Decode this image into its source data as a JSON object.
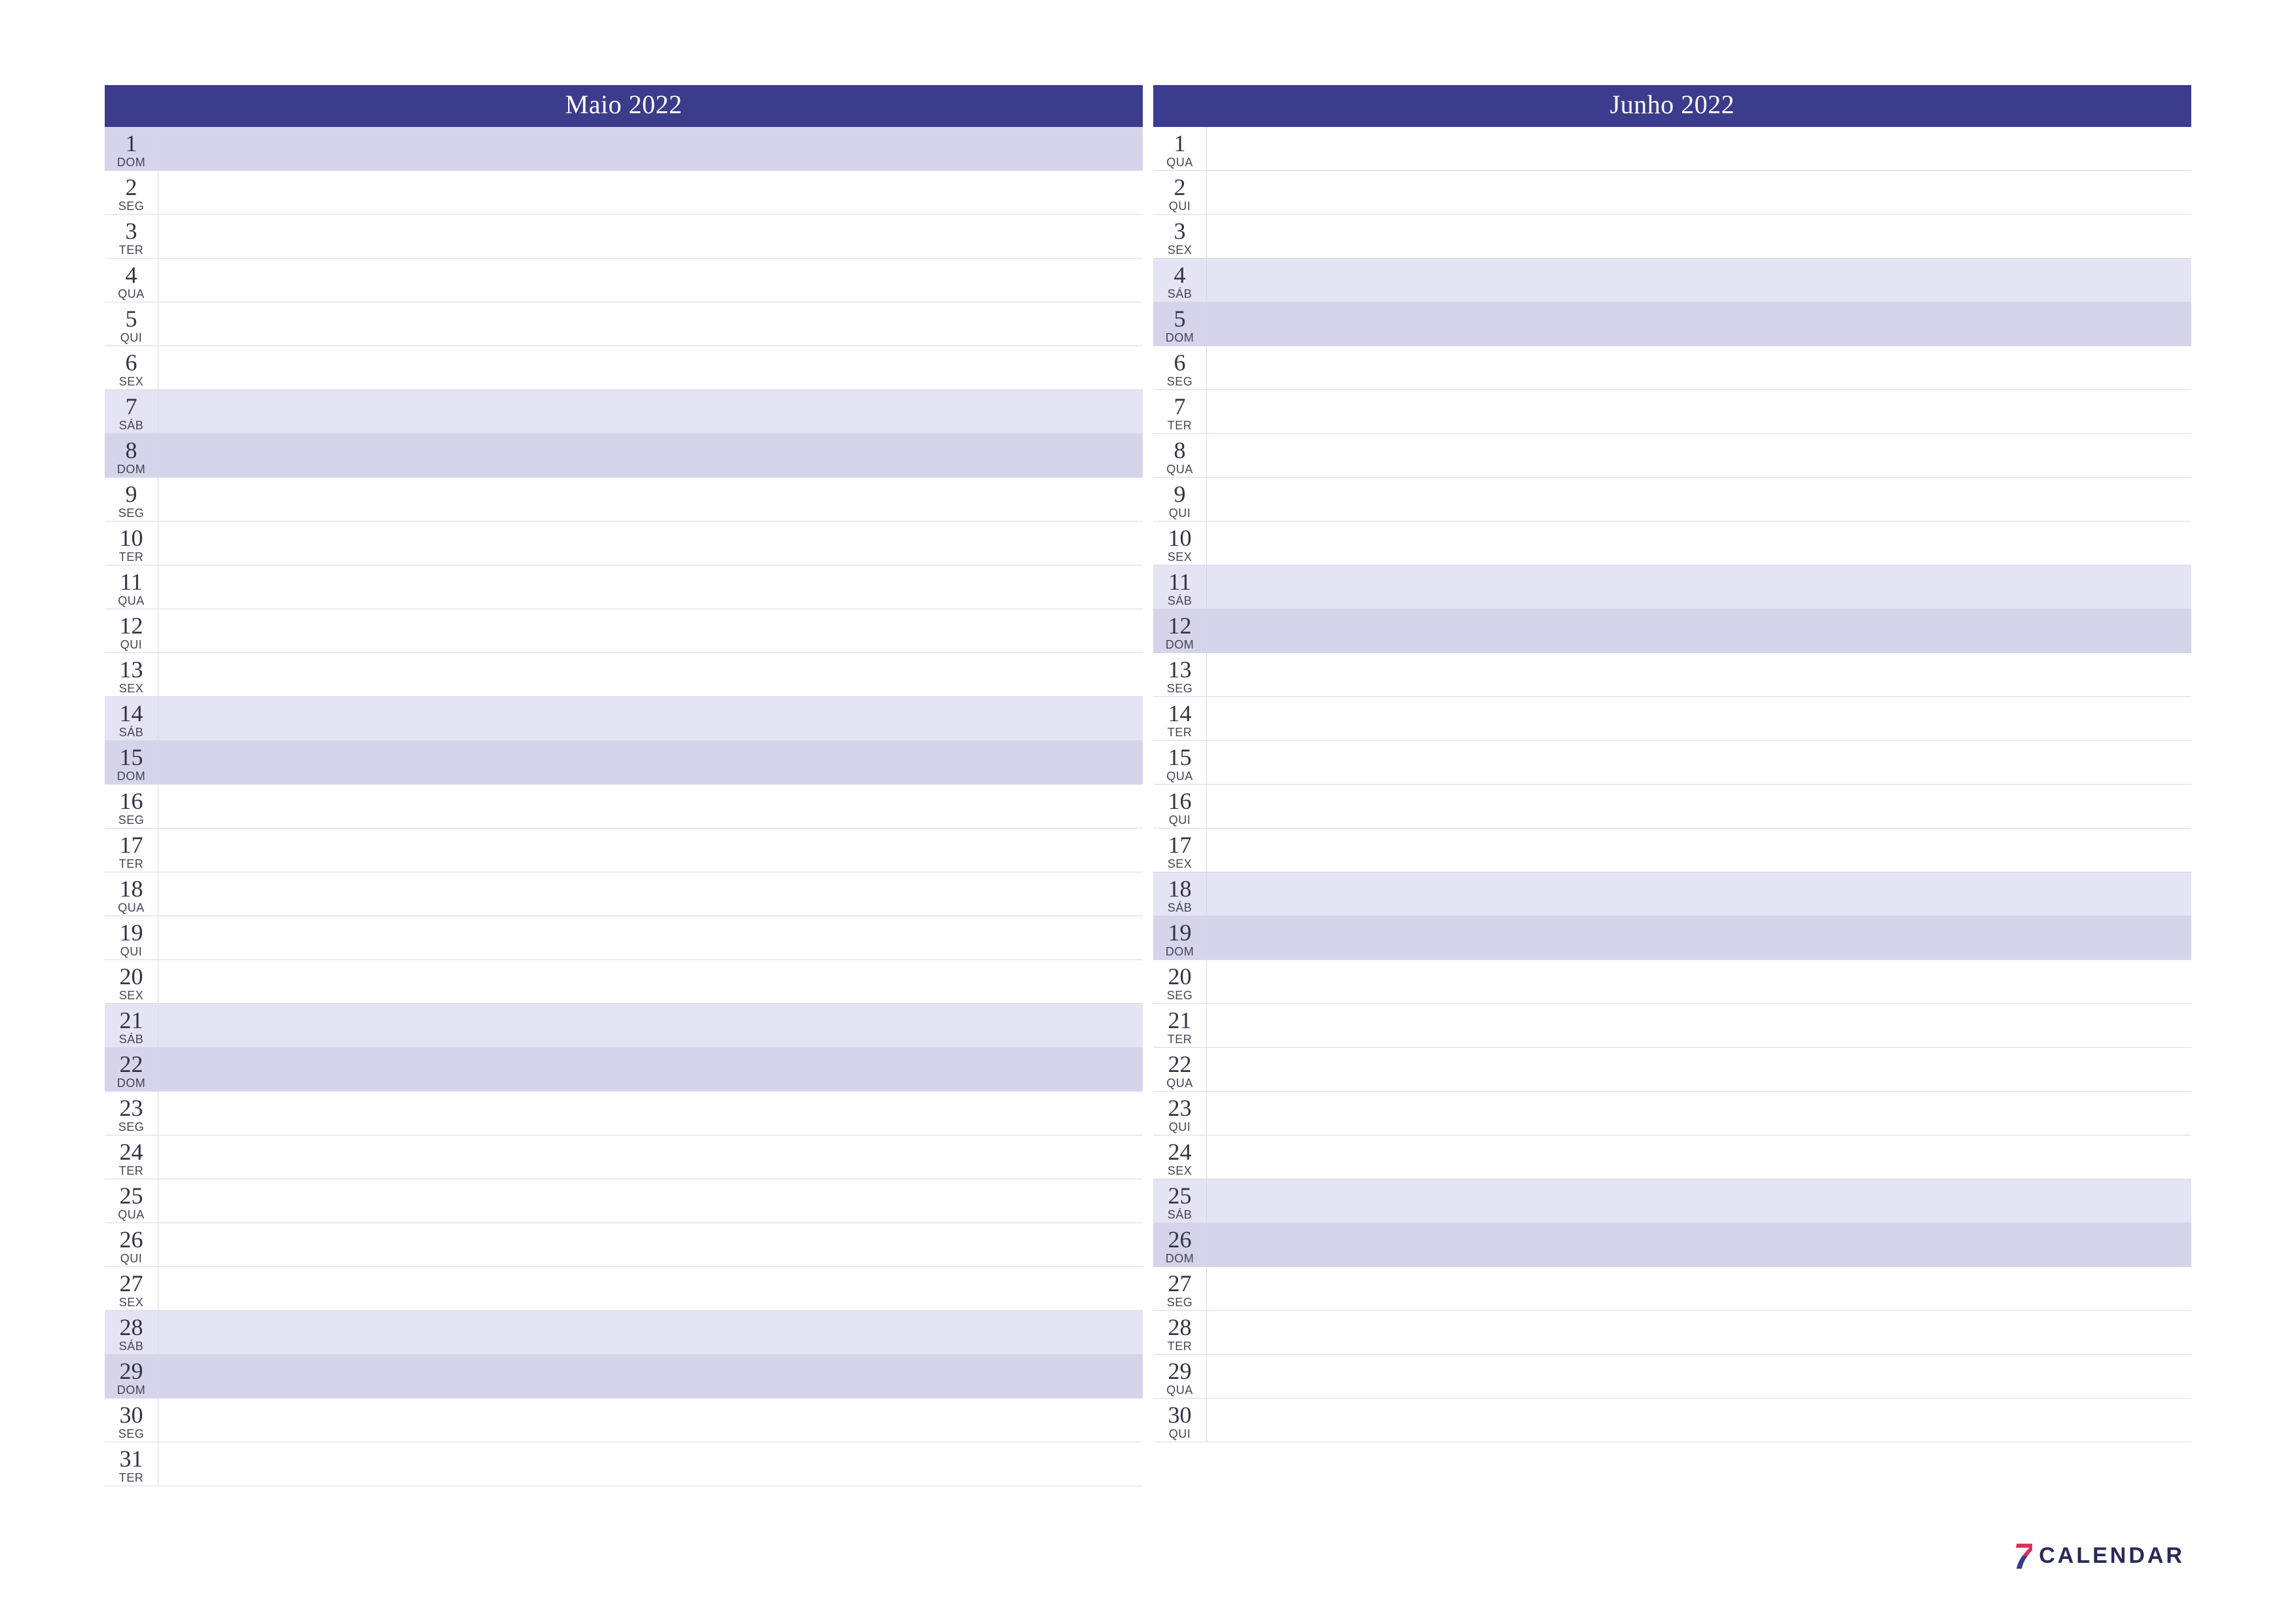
{
  "logo": {
    "mark": "7",
    "text": "CALENDAR"
  },
  "months": [
    {
      "title": "Maio 2022",
      "days": [
        {
          "n": "1",
          "abbr": "DOM",
          "cls": "sun"
        },
        {
          "n": "2",
          "abbr": "SEG",
          "cls": ""
        },
        {
          "n": "3",
          "abbr": "TER",
          "cls": ""
        },
        {
          "n": "4",
          "abbr": "QUA",
          "cls": ""
        },
        {
          "n": "5",
          "abbr": "QUI",
          "cls": ""
        },
        {
          "n": "6",
          "abbr": "SEX",
          "cls": ""
        },
        {
          "n": "7",
          "abbr": "SÁB",
          "cls": "sat"
        },
        {
          "n": "8",
          "abbr": "DOM",
          "cls": "sun"
        },
        {
          "n": "9",
          "abbr": "SEG",
          "cls": ""
        },
        {
          "n": "10",
          "abbr": "TER",
          "cls": ""
        },
        {
          "n": "11",
          "abbr": "QUA",
          "cls": ""
        },
        {
          "n": "12",
          "abbr": "QUI",
          "cls": ""
        },
        {
          "n": "13",
          "abbr": "SEX",
          "cls": ""
        },
        {
          "n": "14",
          "abbr": "SÁB",
          "cls": "sat"
        },
        {
          "n": "15",
          "abbr": "DOM",
          "cls": "sun"
        },
        {
          "n": "16",
          "abbr": "SEG",
          "cls": ""
        },
        {
          "n": "17",
          "abbr": "TER",
          "cls": ""
        },
        {
          "n": "18",
          "abbr": "QUA",
          "cls": ""
        },
        {
          "n": "19",
          "abbr": "QUI",
          "cls": ""
        },
        {
          "n": "20",
          "abbr": "SEX",
          "cls": ""
        },
        {
          "n": "21",
          "abbr": "SÁB",
          "cls": "sat"
        },
        {
          "n": "22",
          "abbr": "DOM",
          "cls": "sun"
        },
        {
          "n": "23",
          "abbr": "SEG",
          "cls": ""
        },
        {
          "n": "24",
          "abbr": "TER",
          "cls": ""
        },
        {
          "n": "25",
          "abbr": "QUA",
          "cls": ""
        },
        {
          "n": "26",
          "abbr": "QUI",
          "cls": ""
        },
        {
          "n": "27",
          "abbr": "SEX",
          "cls": ""
        },
        {
          "n": "28",
          "abbr": "SÁB",
          "cls": "sat"
        },
        {
          "n": "29",
          "abbr": "DOM",
          "cls": "sun"
        },
        {
          "n": "30",
          "abbr": "SEG",
          "cls": ""
        },
        {
          "n": "31",
          "abbr": "TER",
          "cls": ""
        }
      ]
    },
    {
      "title": "Junho 2022",
      "days": [
        {
          "n": "1",
          "abbr": "QUA",
          "cls": ""
        },
        {
          "n": "2",
          "abbr": "QUI",
          "cls": ""
        },
        {
          "n": "3",
          "abbr": "SEX",
          "cls": ""
        },
        {
          "n": "4",
          "abbr": "SÁB",
          "cls": "sat"
        },
        {
          "n": "5",
          "abbr": "DOM",
          "cls": "sun"
        },
        {
          "n": "6",
          "abbr": "SEG",
          "cls": ""
        },
        {
          "n": "7",
          "abbr": "TER",
          "cls": ""
        },
        {
          "n": "8",
          "abbr": "QUA",
          "cls": ""
        },
        {
          "n": "9",
          "abbr": "QUI",
          "cls": ""
        },
        {
          "n": "10",
          "abbr": "SEX",
          "cls": ""
        },
        {
          "n": "11",
          "abbr": "SÁB",
          "cls": "sat"
        },
        {
          "n": "12",
          "abbr": "DOM",
          "cls": "sun"
        },
        {
          "n": "13",
          "abbr": "SEG",
          "cls": ""
        },
        {
          "n": "14",
          "abbr": "TER",
          "cls": ""
        },
        {
          "n": "15",
          "abbr": "QUA",
          "cls": ""
        },
        {
          "n": "16",
          "abbr": "QUI",
          "cls": ""
        },
        {
          "n": "17",
          "abbr": "SEX",
          "cls": ""
        },
        {
          "n": "18",
          "abbr": "SÁB",
          "cls": "sat"
        },
        {
          "n": "19",
          "abbr": "DOM",
          "cls": "sun"
        },
        {
          "n": "20",
          "abbr": "SEG",
          "cls": ""
        },
        {
          "n": "21",
          "abbr": "TER",
          "cls": ""
        },
        {
          "n": "22",
          "abbr": "QUA",
          "cls": ""
        },
        {
          "n": "23",
          "abbr": "QUI",
          "cls": ""
        },
        {
          "n": "24",
          "abbr": "SEX",
          "cls": ""
        },
        {
          "n": "25",
          "abbr": "SÁB",
          "cls": "sat"
        },
        {
          "n": "26",
          "abbr": "DOM",
          "cls": "sun"
        },
        {
          "n": "27",
          "abbr": "SEG",
          "cls": ""
        },
        {
          "n": "28",
          "abbr": "TER",
          "cls": ""
        },
        {
          "n": "29",
          "abbr": "QUA",
          "cls": ""
        },
        {
          "n": "30",
          "abbr": "QUI",
          "cls": ""
        }
      ]
    }
  ]
}
